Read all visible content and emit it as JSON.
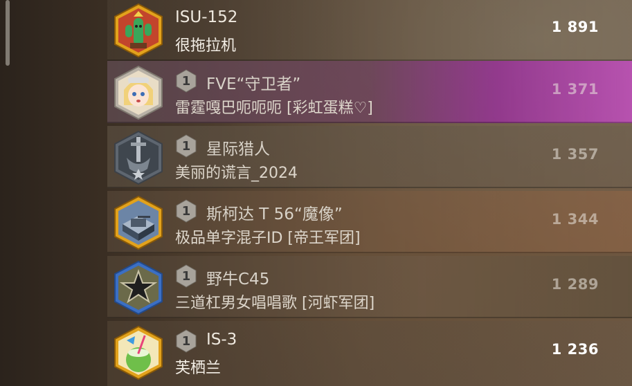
{
  "leaderboard": {
    "rows": [
      {
        "rank": "",
        "name": "ISU-152",
        "player": "很拖拉机",
        "score": "1 891",
        "avatar_icon": "cactus-emblem-icon",
        "frame_color": "#e2a21c",
        "dimmed": false
      },
      {
        "rank": "1",
        "name": "FVE“守卫者”",
        "player": "雷霆嘎巴呃呃呃 [彩虹蛋糕♡]",
        "score": "1 371",
        "avatar_icon": "anime-girl-avatar-icon",
        "frame_color": "#8a8a8a",
        "dimmed": true
      },
      {
        "rank": "1",
        "name": "星际猎人",
        "player": "美丽的谎言_2024",
        "score": "1 357",
        "avatar_icon": "sword-badge-icon",
        "frame_color": "#8a8a8a",
        "dimmed": true
      },
      {
        "rank": "1",
        "name": "斯柯达 T 56“魔像”",
        "player": "极品单字混子ID [帝王军团]",
        "score": "1 344",
        "avatar_icon": "tank-diorama-icon",
        "frame_color": "#e2a21c",
        "dimmed": true
      },
      {
        "rank": "1",
        "name": "野牛C45",
        "player": "三道杠男女唱唱歌 [河虾军团]",
        "score": "1 289",
        "avatar_icon": "star-emblem-icon",
        "frame_color": "#3b6fc4",
        "dimmed": true
      },
      {
        "rank": "1",
        "name": "IS-3",
        "player": "芙栖兰",
        "score": "1 236",
        "avatar_icon": "coconut-drink-icon",
        "frame_color": "#e2a21c",
        "dimmed": false
      }
    ]
  },
  "colors": {
    "gold_frame": "#e2a21c",
    "blue_frame": "#3b6fc4",
    "grey_frame": "#8a8a8a",
    "score_text": "#ffffff"
  }
}
